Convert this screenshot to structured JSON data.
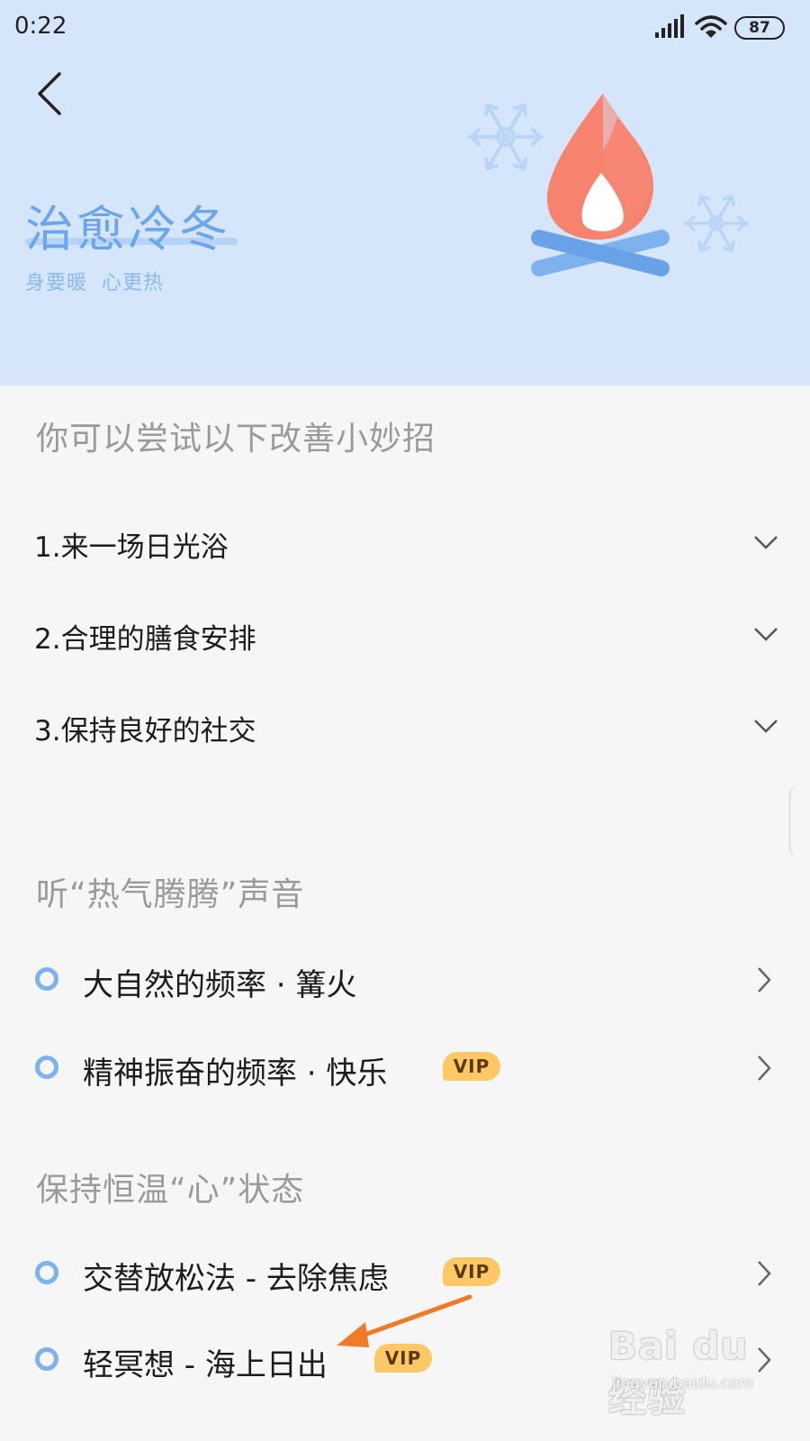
{
  "status_bar": {
    "time": "0:22",
    "battery": "87",
    "icons": [
      "signal-icon",
      "wifi-icon",
      "battery-icon"
    ]
  },
  "header": {
    "back_icon": "chevron-left-icon",
    "title": "治愈冷冬",
    "subtitle": "身要暖  心更热",
    "illustration": [
      "campfire-icon",
      "snowflake-icon"
    ],
    "colors": {
      "background": "#d5e6fb",
      "title": "#6aa6ee",
      "flame": "#f7836f",
      "logs": "#7db2ee"
    }
  },
  "tips": {
    "title": "你可以尝试以下改善小妙招",
    "items": [
      {
        "label": "1.来一场日光浴",
        "icon": "chevron-down-icon"
      },
      {
        "label": "2.合理的膳食安排",
        "icon": "chevron-down-icon"
      },
      {
        "label": "3.保持良好的社交",
        "icon": "chevron-down-icon"
      }
    ]
  },
  "sounds": {
    "title": "听“热气腾腾”声音",
    "items": [
      {
        "label": "大自然的频率 · 篝火",
        "vip": false
      },
      {
        "label": "精神振奋的频率 · 快乐",
        "vip": true,
        "badge": "VIP"
      }
    ]
  },
  "mind": {
    "title": "保持恒温“心”状态",
    "items": [
      {
        "label": "交替放松法 - 去除焦虑",
        "vip": true,
        "badge": "VIP"
      },
      {
        "label": "轻冥想 - 海上日出",
        "vip": true,
        "badge": "VIP"
      }
    ]
  },
  "watermark": {
    "logo": "Bai du 经验",
    "url": "jingyan.baidu.com"
  },
  "colors": {
    "accent": "#7db2ee",
    "vip_badge": "#fdc865",
    "annotation_arrow": "#f07a2a",
    "section_title": "#9a9a9a"
  }
}
